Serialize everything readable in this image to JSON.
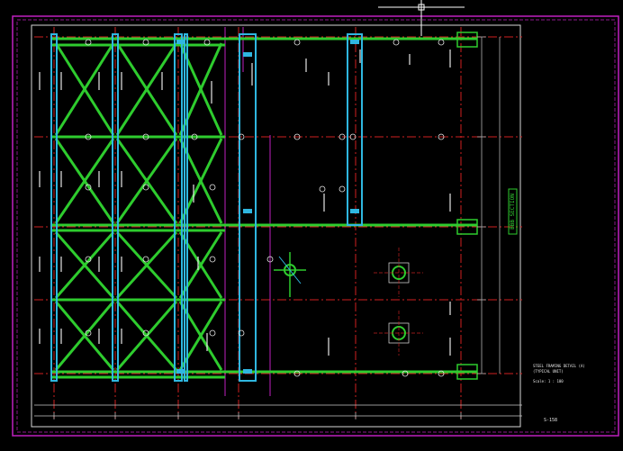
{
  "drawing": {
    "section_label": "BBB SECTION",
    "sheet_no": "S-158",
    "title_lines": [
      "STEEL FRAMING DETAIL (A)",
      "(TYPICAL UNIT)"
    ],
    "scale_note": "Scale: 1 : 100"
  },
  "colors": {
    "background": "#000000",
    "sheet_border": "#c020c0",
    "frame": "#d8d8d8",
    "beam": "#2ecc2e",
    "column": "#2fb7e0",
    "gridline": "#d02020",
    "dimension": "#c8c8c8",
    "text": "#e6e6e6",
    "magenta_line": "#c020c0",
    "crosshair": "#ffffff"
  },
  "icons": {
    "crosshair": "cursor-crosshair-icon",
    "detail_bubble": "detail-bubble-icon"
  }
}
